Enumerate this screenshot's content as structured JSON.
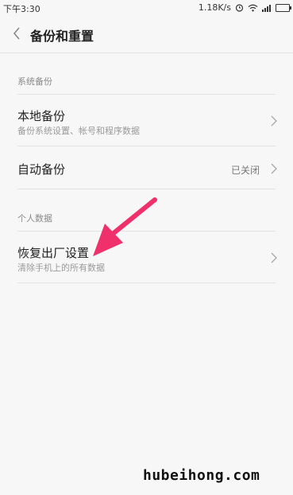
{
  "status_bar": {
    "time": "下午3:30",
    "network_speed": "1.18K/s",
    "icons": [
      "alarm-icon",
      "wifi-icon",
      "signal-icon",
      "battery-icon"
    ]
  },
  "header": {
    "back_icon": "chevron-left-icon",
    "title": "备份和重置"
  },
  "sections": [
    {
      "label": "系统备份",
      "items": [
        {
          "title": "本地备份",
          "subtitle": "备份系统设置、帐号和程序数据",
          "value": ""
        },
        {
          "title": "自动备份",
          "subtitle": "",
          "value": "已关闭"
        }
      ]
    },
    {
      "label": "个人数据",
      "items": [
        {
          "title": "恢复出厂设置",
          "subtitle": "清除手机上的所有数据",
          "value": ""
        }
      ]
    }
  ],
  "annotation": {
    "arrow_color": "#f0306a"
  },
  "watermark": "hubeihong.com",
  "colors": {
    "background": "#f7f7f7",
    "divider": "#e3e3e3",
    "accent_arrow": "#f0306a"
  }
}
